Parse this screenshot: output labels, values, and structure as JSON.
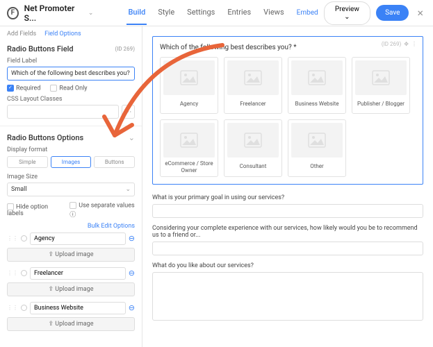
{
  "header": {
    "title": "Net Promoter S...",
    "tabs": [
      "Build",
      "Style",
      "Settings",
      "Entries",
      "Views"
    ],
    "embed": "Embed",
    "preview": "Preview",
    "save": "Save"
  },
  "sidebar": {
    "subtabs": [
      "Add Fields",
      "Field Options"
    ],
    "field_heading": "Radio Buttons Field",
    "field_id": "(ID 269)",
    "field_label_lbl": "Field Label",
    "field_label_val": "Which of the following best describes you?",
    "required": "Required",
    "readonly": "Read Only",
    "css_label": "CSS Layout Classes",
    "options_heading": "Radio Buttons Options",
    "display_format": "Display format",
    "seg": [
      "Simple",
      "Images",
      "Buttons"
    ],
    "image_size_lbl": "Image Size",
    "image_size_val": "Small",
    "hide_labels": "Hide option labels",
    "separate_vals": "Use separate values",
    "bulk": "Bulk Edit Options",
    "upload": "Upload image",
    "options": [
      "Agency",
      "Freelancer",
      "Business Website"
    ]
  },
  "canvas": {
    "q1": "Which of the following best describes you? *",
    "id_badge": "(ID 269)",
    "cards": [
      "Agency",
      "Freelancer",
      "Business Website",
      "Publisher / Blogger",
      "eCommerce / Store Owner",
      "Consultant",
      "Other"
    ],
    "q2": "What is your primary goal in using our services?",
    "q3": "Considering your complete experience with our services, how likely would you be to recommend us to a friend or...",
    "q4": "What do you like about our services?"
  }
}
